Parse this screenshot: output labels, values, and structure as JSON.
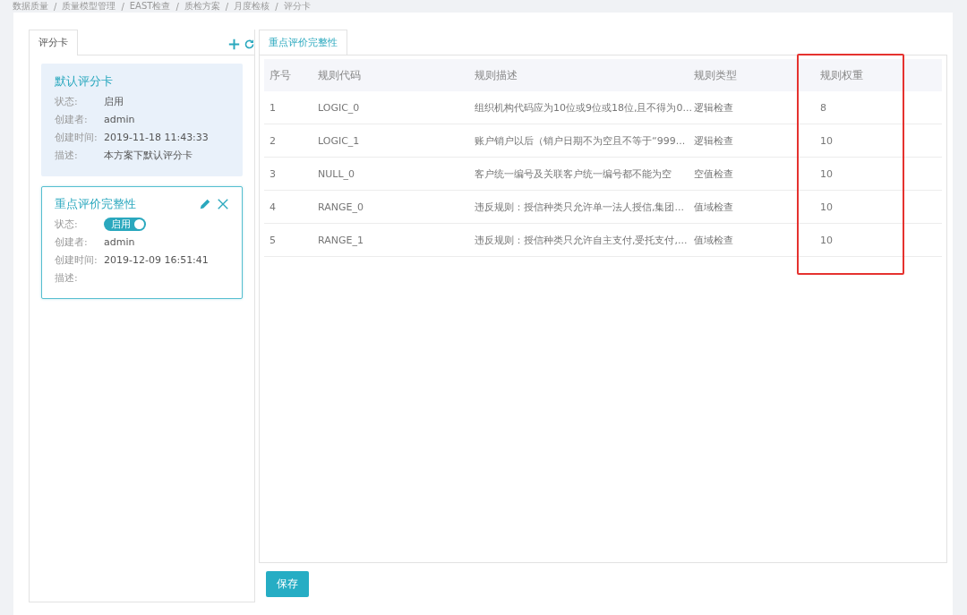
{
  "breadcrumb": {
    "separator": "/",
    "items": [
      "数据质量",
      "质量模型管理",
      "EAST检查",
      "质检方案",
      "月度检核",
      "评分卡"
    ]
  },
  "left_panel": {
    "tab": {
      "label": "评分卡",
      "selected": true
    },
    "cards": [
      {
        "title": "默认评分卡",
        "selected": false,
        "editable": false,
        "fields": [
          {
            "label": "状态:",
            "kind": "text",
            "value": "启用"
          },
          {
            "label": "创建者:",
            "kind": "text",
            "value": "admin"
          },
          {
            "label": "创建时间:",
            "kind": "text",
            "value": "2019-11-18 11:43:33"
          },
          {
            "label": "描述:",
            "kind": "text",
            "value": "本方案下默认评分卡"
          }
        ]
      },
      {
        "title": "重点评价完整性",
        "selected": true,
        "editable": true,
        "fields": [
          {
            "label": "状态:",
            "kind": "switch",
            "value": "启用",
            "on": true
          },
          {
            "label": "创建者:",
            "kind": "text",
            "value": "admin"
          },
          {
            "label": "创建时间:",
            "kind": "text",
            "value": "2019-12-09 16:51:41"
          },
          {
            "label": "描述:",
            "kind": "text"
          }
        ]
      }
    ]
  },
  "right_panel": {
    "tab": {
      "label": "重点评价完整性",
      "selected": true
    },
    "table": {
      "columns": [
        "序号",
        "规则代码",
        "规则描述",
        "规则类型",
        "规则权重"
      ],
      "last_column_highlighted": true,
      "rows": [
        [
          "1",
          "LOGIC_0",
          "组织机构代码应为10位或9位或18位,且不得为0...",
          "逻辑检查",
          "8"
        ],
        [
          "2",
          "LOGIC_1",
          "账户销户以后（销户日期不为空且不等于“999...",
          "逻辑检查",
          "10"
        ],
        [
          "3",
          "NULL_0",
          "客户统一编号及关联客户统一编号都不能为空",
          "空值检查",
          "10"
        ],
        [
          "4",
          "RANGE_0",
          "违反规则：授信种类只允许单一法人授信,集团...",
          "值域检查",
          "10"
        ],
        [
          "5",
          "RANGE_1",
          "违反规则：授信种类只允许自主支付,受托支付,...",
          "值域检查",
          "10"
        ]
      ]
    },
    "save_button": "保存"
  }
}
